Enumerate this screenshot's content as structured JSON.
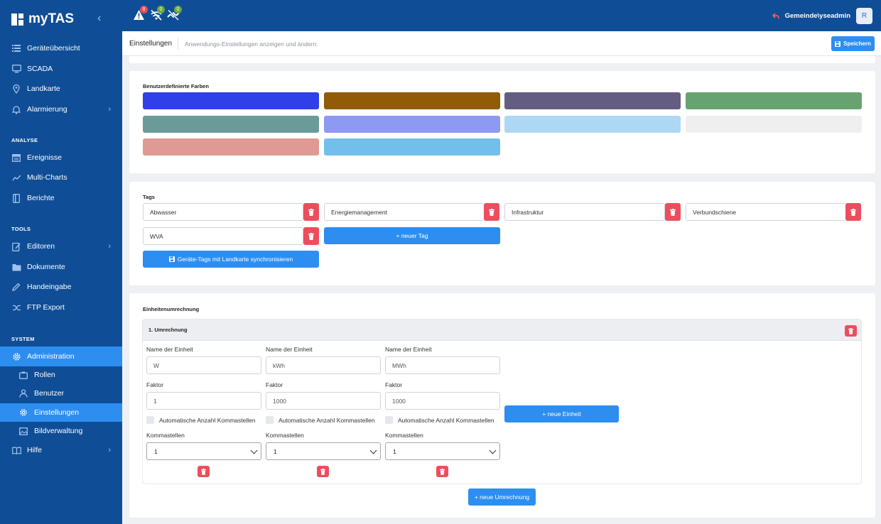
{
  "app": {
    "name": "myTAS"
  },
  "sidebar": {
    "items": [
      {
        "label": "Geräteübersicht"
      },
      {
        "label": "SCADA"
      },
      {
        "label": "Landkarte"
      },
      {
        "label": "Alarmierung"
      },
      {
        "label": "Ereignisse"
      },
      {
        "label": "Multi-Charts"
      },
      {
        "label": "Berichte"
      },
      {
        "label": "Editoren"
      },
      {
        "label": "Dokumente"
      },
      {
        "label": "Handeingabe"
      },
      {
        "label": "FTP Export"
      },
      {
        "label": "Administration"
      },
      {
        "label": "Rollen"
      },
      {
        "label": "Benutzer"
      },
      {
        "label": "Einstellungen"
      },
      {
        "label": "Bildverwaltung"
      },
      {
        "label": "Hilfe"
      }
    ],
    "sections": {
      "analyse": "ANALYSE",
      "tools": "TOOLS",
      "system": "SYSTEM"
    }
  },
  "topbar": {
    "alerts": [
      {
        "icon": "warning-icon",
        "count": "8",
        "color": "#e84b5a"
      },
      {
        "icon": "no-connection-icon",
        "count": "0",
        "color": "#6aaa3a"
      },
      {
        "icon": "satellite-off-icon",
        "count": "0",
        "color": "#6aaa3a"
      }
    ],
    "user": {
      "name": "Gemeinde\\yseadmin",
      "avatar": "R"
    }
  },
  "header": {
    "title": "Einstellungen",
    "subtitle": "Anwendungs-Einstellungen anzeigen und ändern.",
    "save_label": "Speichern"
  },
  "colors": {
    "title": "Benutzerdefinierte Farben",
    "swatches": [
      "#2f40e8",
      "#925b07",
      "#645d82",
      "#66a370",
      "#6b9b99",
      "#8e99f3",
      "#add8f4",
      "#efefef",
      "#de9a93",
      "#72bfeb"
    ]
  },
  "tags": {
    "title": "Tags",
    "items": [
      "Abwasser",
      "Energiemanagement",
      "Infrastruktur",
      "Verbundschiene",
      "WVA"
    ],
    "new_tag_label": "+ neuer Tag",
    "sync_label": "Geräte-Tags mit Landkarte synchronisieren"
  },
  "units": {
    "title": "Einheitenumrechnung",
    "conversion_title": "1. Umrechnung",
    "name_label": "Name der Einheit",
    "factor_label": "Faktor",
    "auto_label": "Automatische Anzahl Kommastellen",
    "decimals_label": "Kommastellen",
    "columns": [
      {
        "name": "W",
        "factor": "1",
        "decimals": "1"
      },
      {
        "name": "kWh",
        "factor": "1000",
        "decimals": "1"
      },
      {
        "name": "MWh",
        "factor": "1000",
        "decimals": "1"
      }
    ],
    "new_unit_label": "+ neue Einheit",
    "new_conversion_label": "+ neue Umrechnung"
  }
}
